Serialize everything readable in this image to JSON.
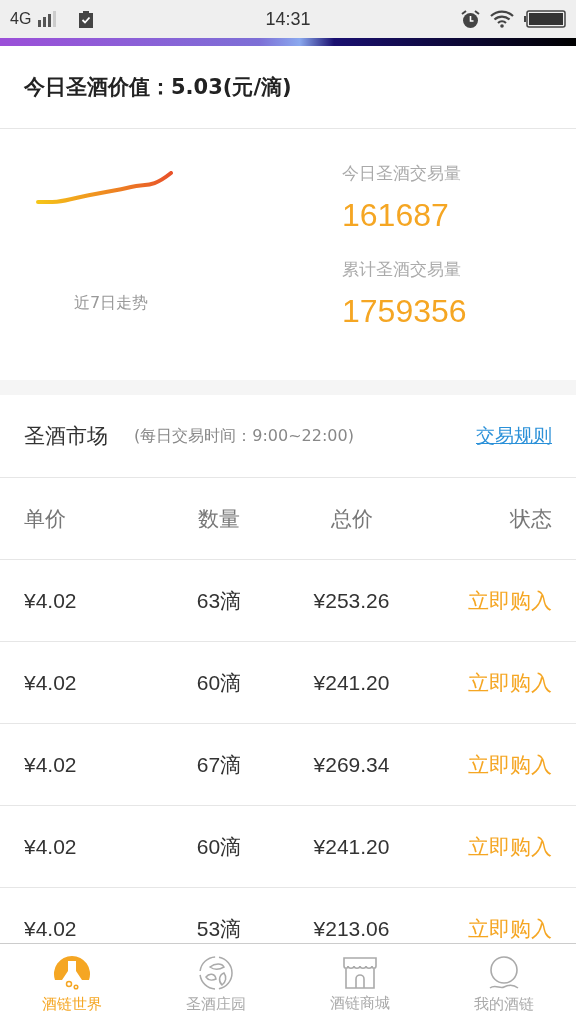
{
  "status_bar": {
    "network": "4G",
    "time": "14:31"
  },
  "price_header": {
    "text": "今日圣酒价值：5.03(元/滴)"
  },
  "stats": {
    "trend_label": "近7日走势",
    "items": [
      {
        "label": "今日圣酒交易量",
        "value": "161687"
      },
      {
        "label": "累计圣酒交易量",
        "value": "1759356"
      }
    ]
  },
  "market": {
    "title": "圣酒市场",
    "hours": "(每日交易时间：9:00~22:00)",
    "rules_link": "交易规则"
  },
  "table": {
    "columns": [
      "单价",
      "数量",
      "总价",
      "状态"
    ],
    "rows": [
      {
        "price": "¥4.02",
        "quantity": "63滴",
        "total": "¥253.26",
        "action": "立即购入"
      },
      {
        "price": "¥4.02",
        "quantity": "60滴",
        "total": "¥241.20",
        "action": "立即购入"
      },
      {
        "price": "¥4.02",
        "quantity": "67滴",
        "total": "¥269.34",
        "action": "立即购入"
      },
      {
        "price": "¥4.02",
        "quantity": "60滴",
        "total": "¥241.20",
        "action": "立即购入"
      },
      {
        "price": "¥4.02",
        "quantity": "53滴",
        "total": "¥213.06",
        "action": "立即购入"
      }
    ]
  },
  "tab_bar": [
    {
      "kind": "world",
      "label": "酒链世界",
      "selected": true
    },
    {
      "kind": "estate",
      "label": "圣酒庄园",
      "selected": false
    },
    {
      "kind": "shop",
      "label": "酒链商城",
      "selected": false
    },
    {
      "kind": "profile",
      "label": "我的酒链",
      "selected": false
    }
  ]
}
